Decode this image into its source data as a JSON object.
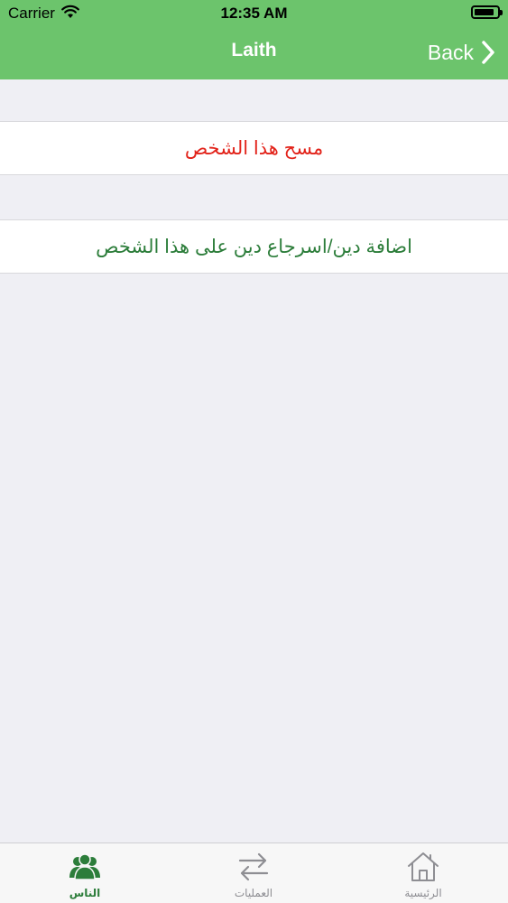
{
  "status_bar": {
    "carrier": "Carrier",
    "time": "12:35 AM",
    "wifi_icon": "wifi-icon",
    "battery_icon": "battery-icon"
  },
  "nav": {
    "title": "Laith",
    "back_label": "Back",
    "back_icon": "chevron-right-icon"
  },
  "actions": {
    "delete_person": "مسح هذا الشخص",
    "add_return_debt": "اضافة دين/اسرجاع دين على هذا الشخص"
  },
  "tab_bar": {
    "tabs": [
      {
        "label": "الناس",
        "icon": "people-icon",
        "selected": true
      },
      {
        "label": "العمليات",
        "icon": "transfer-arrows-icon",
        "selected": false
      },
      {
        "label": "الرئيسية",
        "icon": "home-icon",
        "selected": false
      }
    ]
  },
  "colors": {
    "header": "#6cc46c",
    "background": "#efeff4",
    "delete_text": "#e2231a",
    "debt_text": "#2c7d3a",
    "tab_selected": "#2c7d3a",
    "tab_unselected": "#8e8e93"
  }
}
